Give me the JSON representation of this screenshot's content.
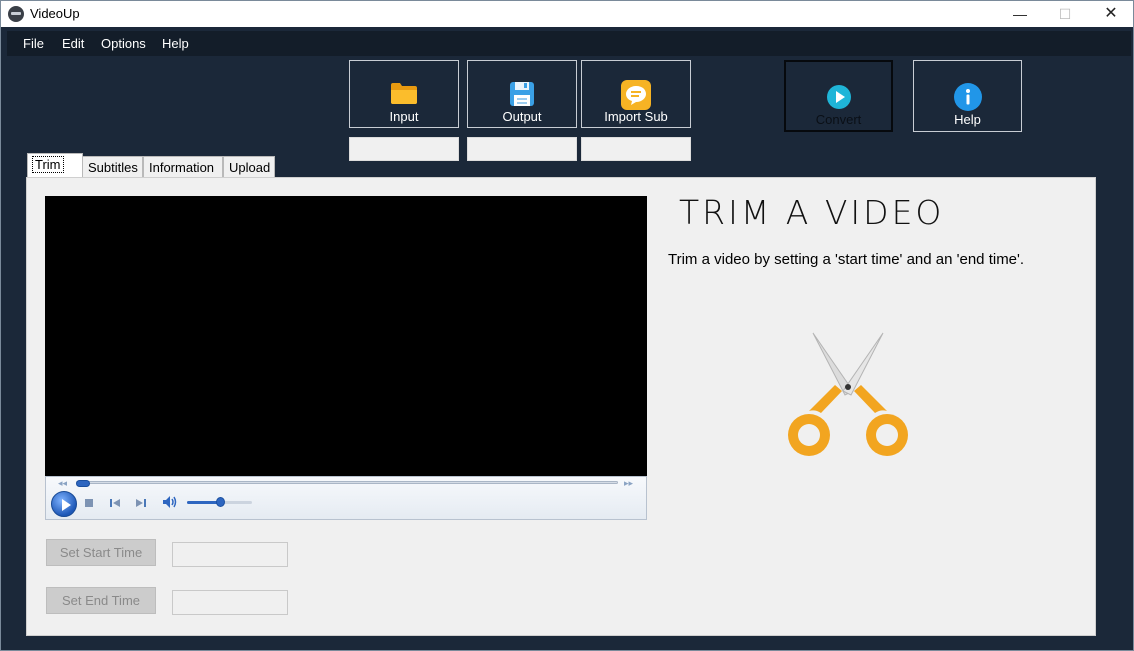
{
  "window": {
    "title": "VideoUp",
    "minimize": "—",
    "maximize": "☐",
    "close": "✕"
  },
  "menu": {
    "file": "File",
    "edit": "Edit",
    "options": "Options",
    "help": "Help"
  },
  "toolbar": {
    "input_label": "Input",
    "output_label": "Output",
    "import_sub_label": "Import Sub",
    "convert_label": "Convert",
    "help_label": "Help",
    "input_path": "",
    "output_path": "",
    "subtitle_path": ""
  },
  "tabs": {
    "trim": "Trim",
    "subtitles": "Subtitles",
    "information": "Information",
    "upload": "Upload"
  },
  "player": {
    "seek_fraction": 0.0,
    "volume_fraction": 0.5
  },
  "trim": {
    "heading": "TRIM A VIDEO",
    "description": "Trim a video by setting a 'start time' and an 'end time'.",
    "set_start_label": "Set Start Time",
    "set_end_label": "Set End Time",
    "start_value": "",
    "end_value": ""
  },
  "colors": {
    "background": "#1b2839",
    "panel": "#f0f0f0",
    "accent": "#2e66c0",
    "scissor_handle": "#f2a520"
  }
}
